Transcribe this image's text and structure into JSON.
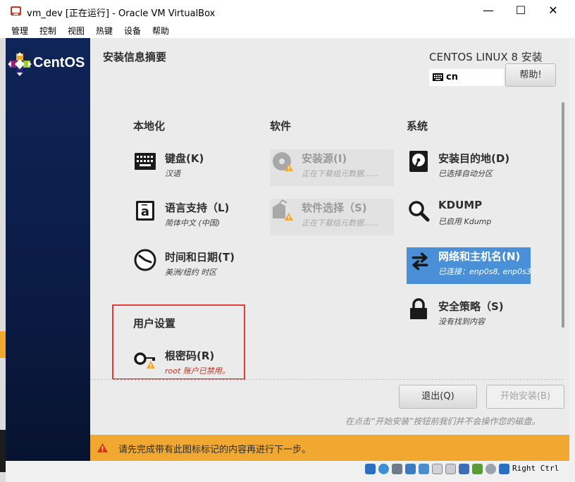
{
  "window": {
    "title": "vm_dev [正在运行] - Oracle VM VirtualBox",
    "minimize": "—",
    "maximize": "☐",
    "close": "✕"
  },
  "menu": [
    "管理",
    "控制",
    "视图",
    "热键",
    "设备",
    "帮助"
  ],
  "sidebar": {
    "brand": "CentOS"
  },
  "header": {
    "title": "安装信息摘要",
    "product": "CENTOS LINUX 8 安装",
    "keyboard_layout": "cn",
    "help_label": "帮助!"
  },
  "categories": {
    "localization": "本地化",
    "software": "软件",
    "system": "系统",
    "user": "用户设置"
  },
  "spokes": {
    "keyboard": {
      "title": "键盘(K)",
      "status": "汉语"
    },
    "language": {
      "title": "语言支持（L)",
      "status": "简体中文 (中国)"
    },
    "datetime": {
      "title": "时间和日期(T)",
      "status": "美洲/纽约 时区"
    },
    "source": {
      "title": "安装源(I)",
      "status": "正在下载组元数据......"
    },
    "software": {
      "title": "软件选择（S)",
      "status": "正在下载组元数据......"
    },
    "destination": {
      "title": "安装目的地(D)",
      "status": "已选择自动分区"
    },
    "kdump": {
      "title": "KDUMP",
      "status": "已启用 Kdump"
    },
    "network": {
      "title": "网络和主机名(N)",
      "status": "已连接：enp0s8, enp0s3"
    },
    "security": {
      "title": "安全策略（S)",
      "status": "没有找到内容"
    },
    "root": {
      "title": "根密码(R)",
      "status": "root 账户已禁用。"
    }
  },
  "buttons": {
    "quit": "退出(Q)",
    "begin": "开始安装(B)"
  },
  "hint": "在点击“开始安装”按钮前我们并不会操作您的磁盘。",
  "warning": "请先完成带有此图标标记的内容再进行下一步。",
  "statusbar": {
    "host_key": "Right Ctrl"
  },
  "colors": {
    "accent": "#4a90d9",
    "warning": "#f0a830",
    "sidebar": "#0b1e4a",
    "highlight_box": "#e53935"
  }
}
